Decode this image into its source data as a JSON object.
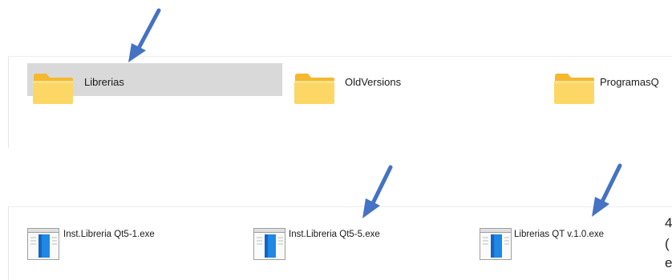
{
  "folders": [
    {
      "label": "Librerias",
      "selected": true
    },
    {
      "label": "OldVersions",
      "selected": false
    },
    {
      "label": "ProgramasQ",
      "selected": false
    }
  ],
  "files": [
    {
      "label": "Inst.Libreria Qt5-1.exe"
    },
    {
      "label": "Inst.Libreria Qt5-5.exe"
    },
    {
      "label": "Librerias QT v.1.0.exe"
    }
  ],
  "edge_text": [
    "4",
    "(",
    "e"
  ],
  "colors": {
    "selection": "#d9d9d9",
    "folder_body": "#fdd765",
    "folder_tab": "#f5b82e",
    "arrow": "#4472c4",
    "file_blue": "#1565c0"
  }
}
